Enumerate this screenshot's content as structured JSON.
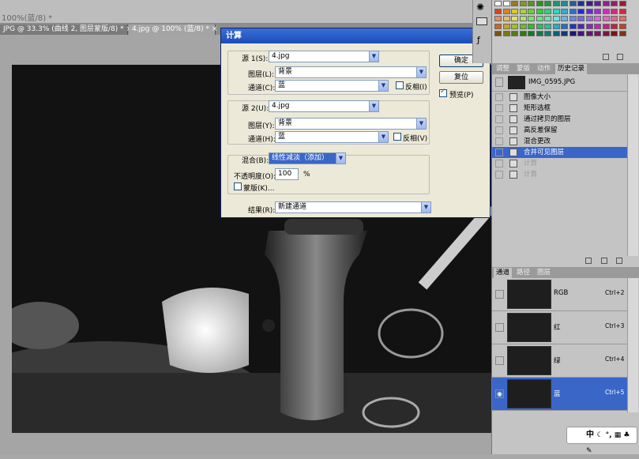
{
  "window": {
    "title": "100%(蓝/8) *"
  },
  "doc_tabs": [
    {
      "label": "JPG @ 33.3% (曲线 2, 图层蒙版/8) *",
      "close": "×"
    },
    {
      "label": "4.jpg @ 100% (蓝/8) *",
      "close": "×"
    }
  ],
  "dialog": {
    "title": "计算",
    "close": "✕",
    "source1": {
      "label": "源 1(S):",
      "file": "4.jpg",
      "layer_label": "图层(L):",
      "layer": "背景",
      "channel_label": "通道(C):",
      "channel": "蓝",
      "invert_label": "反相(I)"
    },
    "source2": {
      "label": "源 2(U):",
      "file": "4.jpg",
      "layer_label": "图层(Y):",
      "layer": "背景",
      "channel_label": "通道(H):",
      "channel": "蓝",
      "invert_label": "反相(V)"
    },
    "blend": {
      "label": "混合(B):",
      "mode": "线性减淡（添加）",
      "opacity_label": "不透明度(O):",
      "opacity": "100",
      "percent": "%",
      "mask_label": "蒙版(K)..."
    },
    "result": {
      "label": "结果(R):",
      "value": "新建通道"
    },
    "ok": "确定",
    "reset": "复位",
    "preview_label": "预览(P)",
    "preview_checked": true
  },
  "history_panel": {
    "tabs": [
      "调整",
      "蒙版",
      "动作",
      "历史记录"
    ],
    "snapshot": "IMG_0595.JPG",
    "items": [
      {
        "label": "图像大小",
        "state": "normal"
      },
      {
        "label": "矩形选框",
        "state": "normal"
      },
      {
        "label": "通过拷贝的图层",
        "state": "normal"
      },
      {
        "label": "高反差保留",
        "state": "normal"
      },
      {
        "label": "混合更改",
        "state": "normal"
      },
      {
        "label": "合并可见图层",
        "state": "selected"
      },
      {
        "label": "计算",
        "state": "dim"
      },
      {
        "label": "计算",
        "state": "dim"
      }
    ]
  },
  "channels_panel": {
    "tabs": [
      "通道",
      "路径",
      "图层"
    ],
    "channels": [
      {
        "name": "RGB",
        "shortcut": "Ctrl+2",
        "visible": false,
        "selected": false
      },
      {
        "name": "红",
        "shortcut": "Ctrl+3",
        "visible": false,
        "selected": false
      },
      {
        "name": "绿",
        "shortcut": "Ctrl+4",
        "visible": false,
        "selected": false
      },
      {
        "name": "蓝",
        "shortcut": "Ctrl+5",
        "visible": true,
        "selected": true
      }
    ]
  },
  "ime": {
    "label": "中"
  },
  "colors": {
    "selection": "#3a66c8",
    "dialog_title": "#2458c8",
    "dialog_bg": "#ece9d8"
  }
}
